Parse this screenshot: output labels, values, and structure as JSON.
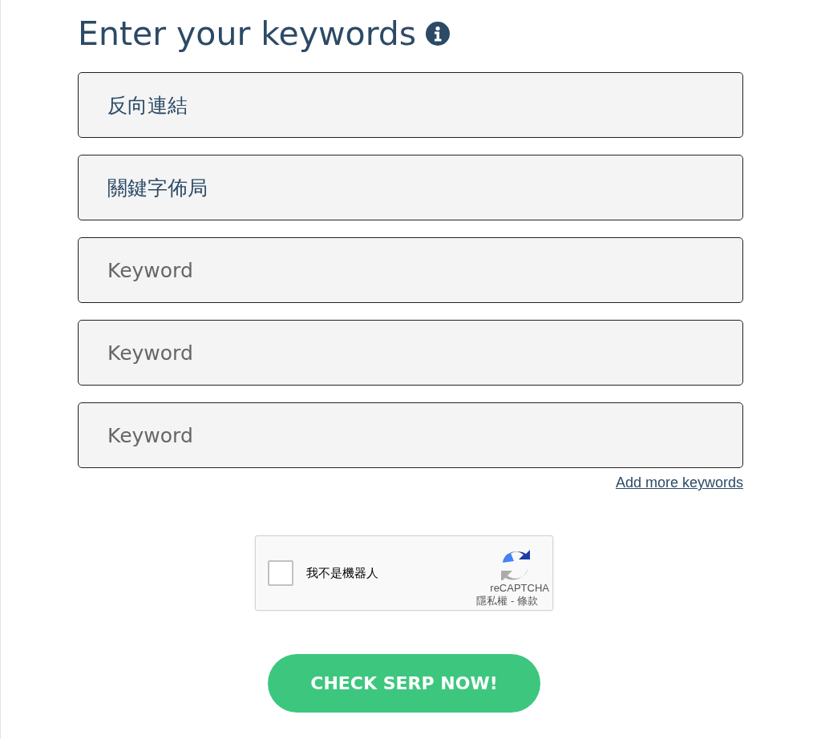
{
  "heading": {
    "title": "Enter your keywords"
  },
  "keywords": [
    {
      "value": "反向連結"
    },
    {
      "value": "關鍵字佈局"
    },
    {
      "placeholder": "Keyword"
    },
    {
      "placeholder": "Keyword"
    },
    {
      "placeholder": "Keyword"
    }
  ],
  "add_more_link": "Add more keywords",
  "captcha": {
    "checked": false,
    "label": "我不是機器人",
    "brand": "reCAPTCHA",
    "footer": "隱私權 - 條款"
  },
  "submit_button": "CHECK SERP NOW!"
}
